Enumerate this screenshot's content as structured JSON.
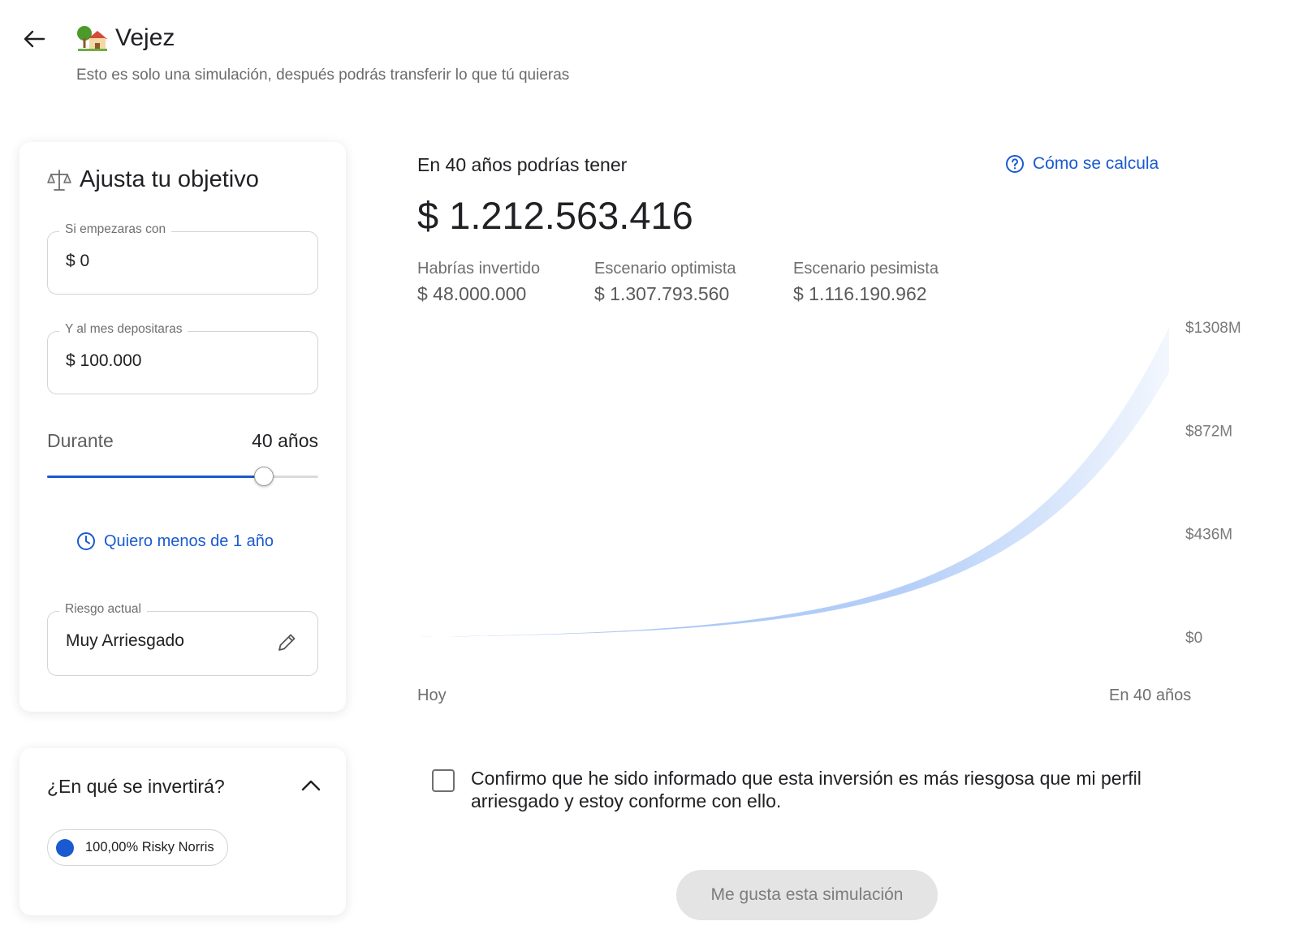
{
  "header": {
    "title": "Vejez",
    "subtitle": "Esto es solo una simulación, después podrás transferir lo que tú quieras"
  },
  "goal_card": {
    "title": "Ajusta tu objetivo",
    "start_field": {
      "label": "Si empezaras con",
      "value": "$ 0"
    },
    "monthly_field": {
      "label": "Y al mes depositaras",
      "value": "$ 100.000"
    },
    "duration": {
      "label": "Durante",
      "value": "40 años",
      "slider_fraction": 0.8
    },
    "less_year_link": "Quiero menos de 1 año",
    "risk_field": {
      "label": "Riesgo actual",
      "value": "Muy Arriesgado"
    }
  },
  "invest_card": {
    "title": "¿En qué se invertirá?",
    "chip_label": "100,00% Risky Norris",
    "chip_color": "#1a5ad0"
  },
  "results": {
    "label": "En 40 años podrías tener",
    "how_link": "Cómo se calcula",
    "amount": "$ 1.212.563.416",
    "stats": [
      {
        "label": "Habrías invertido",
        "value": "$ 48.000.000"
      },
      {
        "label": "Escenario optimista",
        "value": "$ 1.307.793.560"
      },
      {
        "label": "Escenario pesimista",
        "value": "$ 1.116.190.962"
      }
    ]
  },
  "chart_data": {
    "type": "area",
    "x_start_label": "Hoy",
    "x_end_label": "En 40 años",
    "y_ticks": [
      "$1308M",
      "$872M",
      "$436M",
      "$0"
    ],
    "ylim": [
      0,
      1308
    ],
    "xlim": [
      0,
      40
    ],
    "band": {
      "optimistic_end": 1307.79,
      "pessimistic_end": 1116.19
    },
    "fill_color": "#bcd3f8"
  },
  "confirm": {
    "text": "Confirmo que he sido informado que esta inversión es más riesgosa que mi perfil arriesgado y estoy conforme con ello.",
    "checked": false
  },
  "cta": {
    "label": "Me gusta esta simulación"
  },
  "colors": {
    "accent": "#1a5ad0"
  }
}
